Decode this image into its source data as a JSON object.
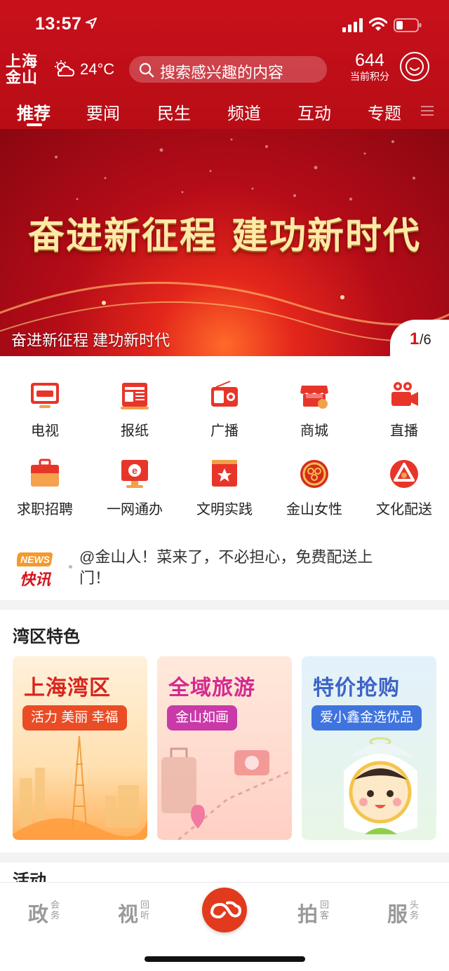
{
  "status_bar": {
    "time": "13:57"
  },
  "header": {
    "city": "上海金山",
    "temperature": "24°C",
    "search_placeholder": "搜索感兴趣的内容",
    "points_value": "644",
    "points_label": "当前积分"
  },
  "tabs": [
    {
      "label": "推荐",
      "active": true
    },
    {
      "label": "要闻"
    },
    {
      "label": "民生"
    },
    {
      "label": "频道"
    },
    {
      "label": "互动"
    },
    {
      "label": "专题"
    }
  ],
  "banner": {
    "slogan": "奋进新征程  建功新时代",
    "caption": "奋进新征程 建功新时代",
    "current": "1",
    "total": "/6"
  },
  "services": [
    {
      "label": "电视",
      "icon": "tv-icon"
    },
    {
      "label": "报纸",
      "icon": "newspaper-icon"
    },
    {
      "label": "广播",
      "icon": "radio-icon"
    },
    {
      "label": "商城",
      "icon": "shop-icon"
    },
    {
      "label": "直播",
      "icon": "video-camera-icon"
    },
    {
      "label": "求职招聘",
      "icon": "briefcase-icon"
    },
    {
      "label": "一网通办",
      "icon": "ie-monitor-icon"
    },
    {
      "label": "文明实践",
      "icon": "star-flag-icon"
    },
    {
      "label": "金山女性",
      "icon": "women-federation-icon"
    },
    {
      "label": "文化配送",
      "icon": "culture-delivery-icon"
    }
  ],
  "news_flash": {
    "badge_top": "NEWS",
    "badge_bottom": "快讯",
    "text": "@金山人！菜来了，不必担心，免费配送上门！"
  },
  "bay_section": {
    "title": "湾区特色",
    "cards": [
      {
        "title": "上海湾区",
        "tag": "活力 美丽 幸福",
        "title_color": "#d8251d",
        "tag_color": "#ea4d25"
      },
      {
        "title": "全域旅游",
        "tag": "金山如画",
        "title_color": "#d42a8f",
        "tag_color": "#c93aa8"
      },
      {
        "title": "特价抢购",
        "tag": "爱小鑫金选优品",
        "title_color": "#3d63c7",
        "tag_color": "#3f74df"
      }
    ]
  },
  "activity_section": {
    "title": "活动"
  },
  "bottom_nav": [
    {
      "big": "政",
      "small": "会务",
      "icon": "politics-icon"
    },
    {
      "big": "视",
      "small": "回听",
      "icon": "view-icon"
    },
    {
      "big": "",
      "small": "",
      "icon": "center-logo-icon"
    },
    {
      "big": "拍",
      "small": "回客",
      "icon": "shoot-icon"
    },
    {
      "big": "服",
      "small": "头务",
      "icon": "service-icon"
    }
  ],
  "colors": {
    "brand_red": "#c8101b",
    "accent": "#e23a1c"
  }
}
